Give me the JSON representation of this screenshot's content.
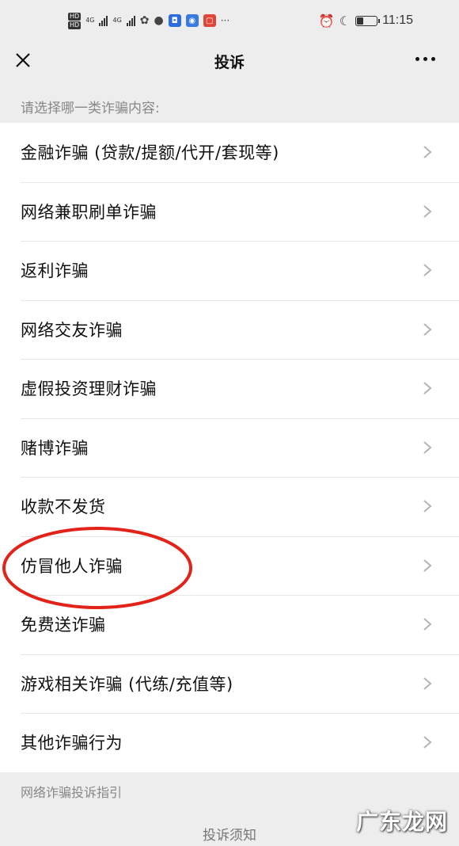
{
  "status_bar": {
    "network_a": "4G",
    "network_b": "4G",
    "hd_a": "HD",
    "hd_b": "HD",
    "battery_level": 0.3,
    "time": "11:15",
    "icons": [
      "wechat-icon",
      "message-icon",
      "app-icon-blue",
      "app-icon-shield",
      "app-icon-red",
      "more-notifications-icon",
      "alarm-icon",
      "moon-icon"
    ]
  },
  "nav": {
    "title": "投诉",
    "close_icon": "close-icon",
    "more_icon": "more-icon"
  },
  "hint": "请选择哪一类诈骗内容:",
  "categories": [
    "金融诈骗 (贷款/提额/代开/套现等)",
    "网络兼职刷单诈骗",
    "返利诈骗",
    "网络交友诈骗",
    "虚假投资理财诈骗",
    "赌博诈骗",
    "收款不发货",
    "仿冒他人诈骗",
    "免费送诈骗",
    "游戏相关诈骗 (代练/充值等)",
    "其他诈骗行为"
  ],
  "highlighted_item": "仿冒他人诈骗",
  "highlight_color": "#e2231a",
  "footer": {
    "guide": "网络诈骗投诉指引",
    "notice": "投诉须知"
  },
  "watermark": "广东龙网"
}
